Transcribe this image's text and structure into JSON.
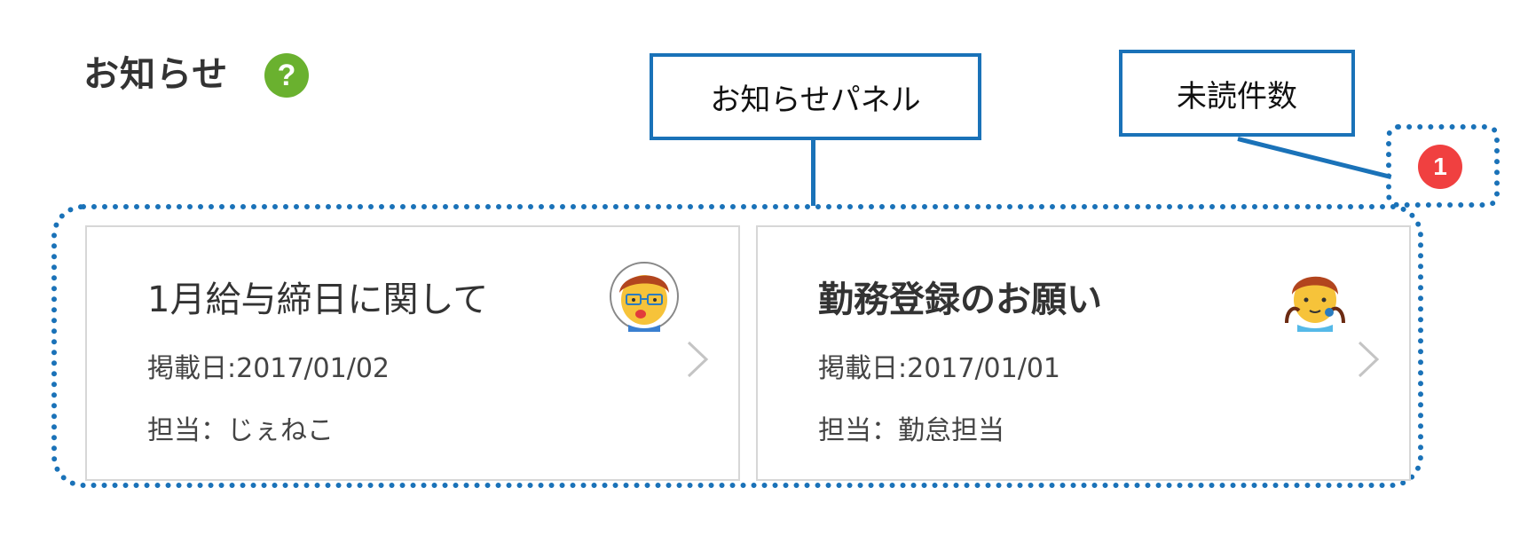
{
  "header": {
    "title": "お知らせ",
    "help_icon": "help-icon",
    "help_glyph": "?"
  },
  "annotations": {
    "panel_label": "お知らせパネル",
    "unread_label": "未読件数"
  },
  "unread": {
    "count": "1",
    "badge_color": "#f04040"
  },
  "notices": [
    {
      "title": "1月給与締日に関して",
      "date": "掲載日:2017/01/02",
      "owner": "担当：じぇねこ",
      "avatar": "avatar-icon-glasses"
    },
    {
      "title": "勤務登録のお願い",
      "date": "掲載日:2017/01/01",
      "owner": "担当：勤怠担当",
      "avatar": "avatar-icon-headset"
    }
  ],
  "colors": {
    "annotation": "#1a72b8",
    "help": "#6ab12f",
    "card_border": "#d7d7d7"
  }
}
